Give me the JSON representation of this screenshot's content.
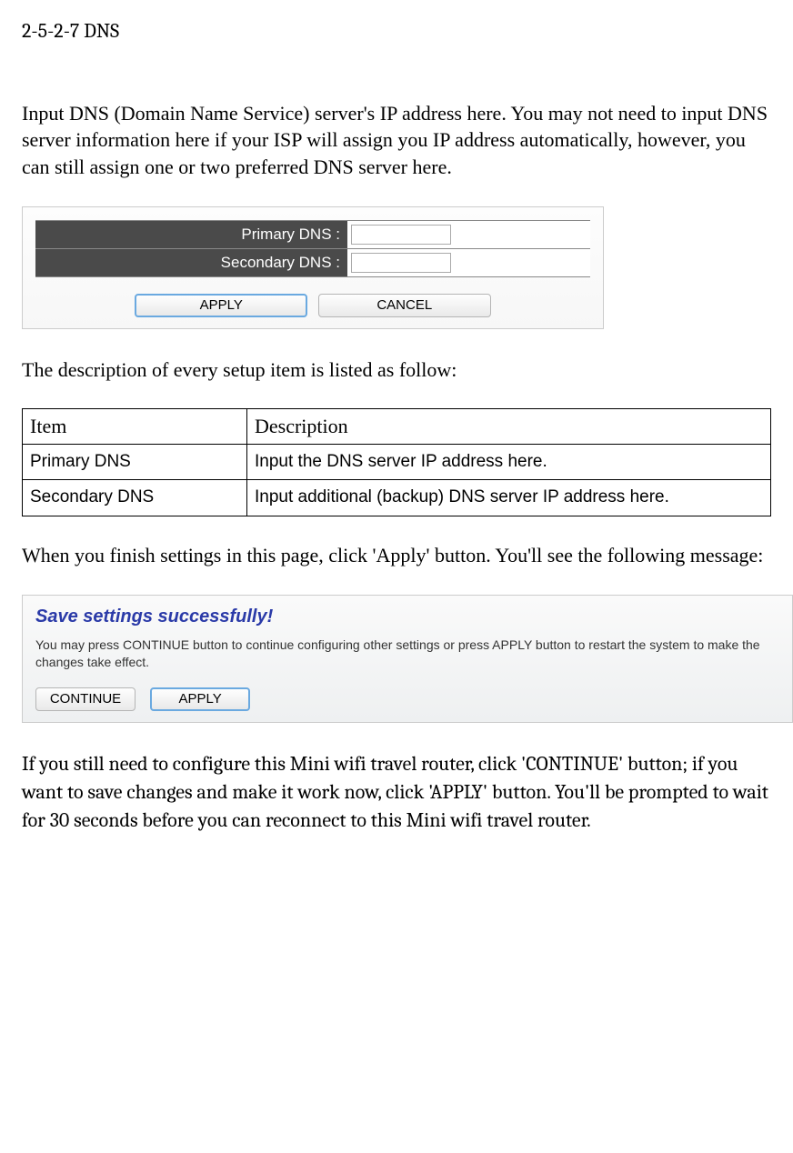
{
  "section_title": "2-5-2-7 DNS",
  "intro_paragraph": "Input DNS (Domain Name Service) server's IP address here. You may not need to input DNS server information here if your ISP will assign you IP address automatically, however, you can still assign one or two preferred DNS server here.",
  "dns_form": {
    "primary_label": "Primary DNS :",
    "secondary_label": "Secondary DNS :",
    "primary_value": "",
    "secondary_value": "",
    "apply_label": "APPLY",
    "cancel_label": "CANCEL"
  },
  "desc_intro": "The description of every setup item is listed as follow:",
  "table": {
    "header_item": "Item",
    "header_desc": "Description",
    "rows": [
      {
        "item": "Primary DNS",
        "desc": "Input the DNS server IP address here."
      },
      {
        "item": "Secondary DNS",
        "desc": "Input additional (backup) DNS server IP address here."
      }
    ]
  },
  "apply_paragraph": "When you finish settings in this page, click 'Apply' button. You'll see the following message:",
  "save_box": {
    "title": "Save settings successfully!",
    "text": "You may press CONTINUE button to continue configuring other settings or press APPLY button to restart the system to make the changes take effect.",
    "continue_label": "CONTINUE",
    "apply_label": "APPLY"
  },
  "final_paragraph": "If you still need to configure this Mini wifi travel router, click 'CONTINUE' button; if you want to save changes and make it work now, click 'APPLY' button. You'll be prompted to wait for 30 seconds before you can reconnect to this Mini wifi travel router."
}
